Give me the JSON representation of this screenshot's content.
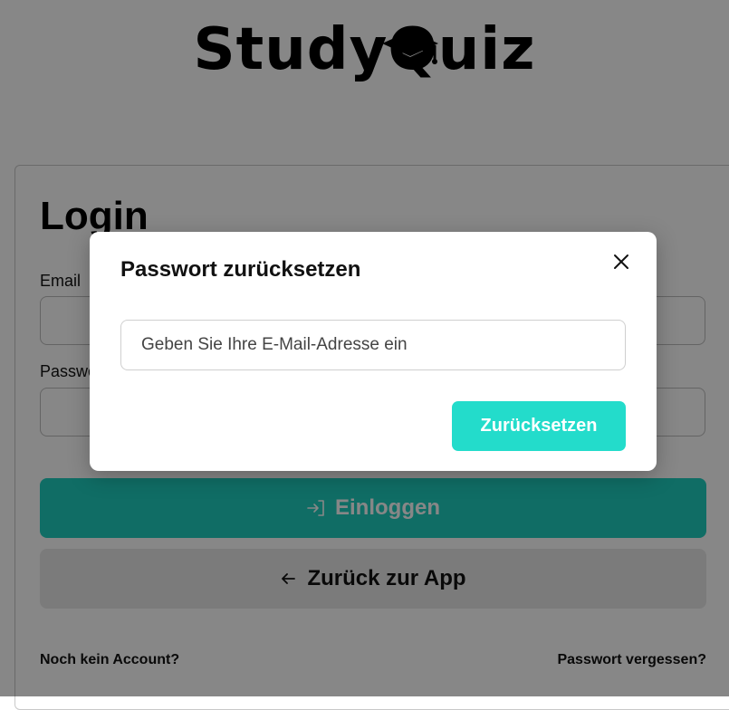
{
  "brand": {
    "logo_text": "StudyQuiz"
  },
  "login": {
    "title": "Login",
    "email_label": "Email",
    "password_label": "Passwort",
    "submit_label": "Einloggen",
    "back_label": "Zurück zur App",
    "no_account_label": "Noch kein Account?",
    "forgot_password_label": "Passwort vergessen?"
  },
  "modal": {
    "title": "Passwort zurücksetzen",
    "email_placeholder": "Geben Sie Ihre E-Mail-Adresse ein",
    "email_value": "",
    "reset_label": "Zurücksetzen"
  },
  "icons": {
    "logo_cap": "graduation-cap-icon",
    "submit": "login-arrow-icon",
    "back": "arrow-left-icon",
    "close": "close-icon"
  },
  "colors": {
    "primary": "#1fcfbf",
    "reset_button": "#23dccb",
    "overlay": "rgba(0,0,0,0.47)"
  }
}
